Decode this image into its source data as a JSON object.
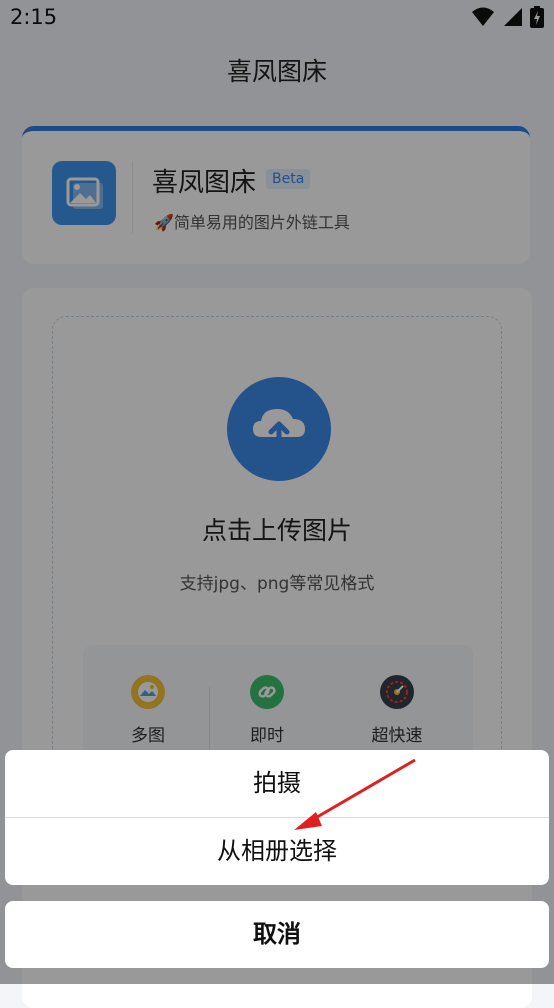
{
  "status_bar": {
    "time": "2:15"
  },
  "nav": {
    "title": "喜凤图床"
  },
  "header": {
    "app_name": "喜凤图床",
    "badge": "Beta",
    "subtitle": "🚀简单易用的图片外链工具",
    "icon": "image-gallery-icon"
  },
  "upload": {
    "title": "点击上传图片",
    "hint": "支持jpg、png等常见格式",
    "icon": "cloud-upload-icon"
  },
  "features": [
    {
      "label": "多图",
      "icon": "photo-gallery-icon"
    },
    {
      "label": "即时",
      "icon": "link-icon"
    },
    {
      "label": "超快速",
      "icon": "speedometer-icon"
    }
  ],
  "action_sheet": {
    "options": [
      "拍摄",
      "从相册选择"
    ],
    "cancel": "取消"
  },
  "annotation": {
    "arrow_color": "#e02020"
  },
  "colors": {
    "accent": "#3b8ae6",
    "overlay": "rgba(0,0,0,0.40)"
  }
}
